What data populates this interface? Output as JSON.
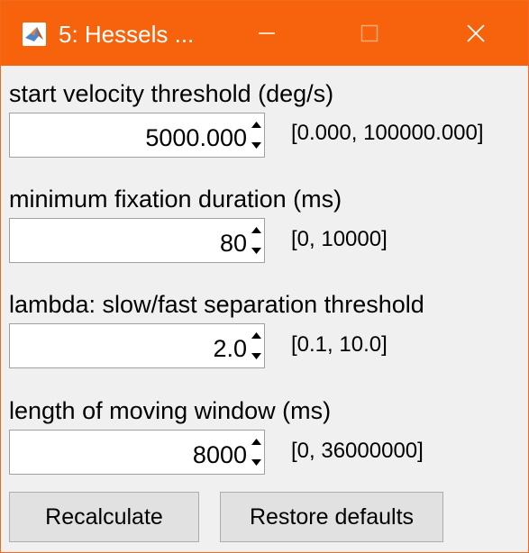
{
  "window": {
    "title": "5: Hessels ...",
    "accent_color": "#f7630c",
    "icon": "matlab-logo-icon"
  },
  "titlebar_controls": [
    "minimize-icon",
    "maximize-icon",
    "close-icon"
  ],
  "fields": [
    {
      "label": "start velocity threshold (deg/s)",
      "value": "5000.000",
      "range": "[0.000, 100000.000]"
    },
    {
      "label": "minimum fixation duration (ms)",
      "value": "80",
      "range": "[0, 10000]"
    },
    {
      "label": "lambda: slow/fast separation threshold",
      "value": "2.0",
      "range": "[0.1, 10.0]"
    },
    {
      "label": "length of moving window (ms)",
      "value": "8000",
      "range": "[0, 36000000]"
    }
  ],
  "buttons": {
    "recalculate": "Recalculate",
    "restore_defaults": "Restore defaults"
  }
}
